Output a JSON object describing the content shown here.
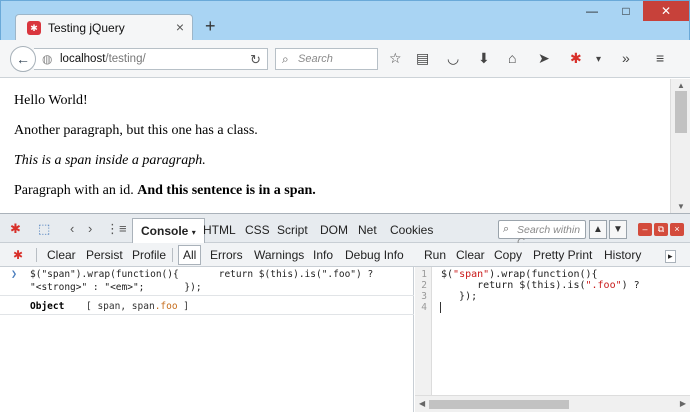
{
  "browser": {
    "tab_title": "Testing jQuery",
    "tab_close_glyph": "×",
    "new_tab_glyph": "+",
    "window_controls": [
      "—",
      "□",
      "✕"
    ],
    "url_host": "localhost",
    "url_path": "/testing/",
    "search_placeholder": "Search",
    "nav_icons": [
      "star-icon",
      "reading-list-icon",
      "pocket-icon",
      "download-icon",
      "home-icon",
      "share-icon",
      "firebug-icon",
      "dropdown-icon",
      "overflow-icon",
      "menu-icon"
    ]
  },
  "page": {
    "para1": "Hello World!",
    "para2": "Another paragraph, but this one has a class.",
    "para3": "This is a span inside a paragraph.",
    "para4_start": "Paragraph with an id.",
    "para4_bold": "And this sentence is in a span."
  },
  "firebug": {
    "panels": [
      "Console",
      "HTML",
      "CSS",
      "Script",
      "DOM",
      "Net",
      "Cookies"
    ],
    "active_panel": "Console",
    "search_placeholder": "Search within C",
    "sub_toolbar": [
      "Clear",
      "Persist",
      "Profile",
      "All",
      "Errors",
      "Warnings",
      "Info",
      "Debug Info"
    ],
    "active_filter": "All",
    "editor_toolbar": [
      "Run",
      "Clear",
      "Copy",
      "Pretty Print",
      "History"
    ],
    "console": {
      "cmd_line1": "$(\"span\").wrap(function(){       return $(this).is(\".foo\") ?",
      "cmd_line2": "\"<strong>\" : \"<em>\";       });",
      "result_label": "Object",
      "result_open": "[ ",
      "result_item1": "span",
      "result_comma": ", ",
      "result_item2_tag": "span",
      "result_item2_class": ".foo",
      "result_close": " ]"
    },
    "editor": {
      "line_numbers": [
        "1",
        "2",
        "3",
        "4"
      ],
      "line1_pre": "$(",
      "line1_str": "\"span\"",
      "line1_post": ").wrap(function(){",
      "line2_pre": "      return $(this).is(",
      "line2_str": "\".foo\"",
      "line2_post": ") ?",
      "line3": "   });"
    }
  }
}
